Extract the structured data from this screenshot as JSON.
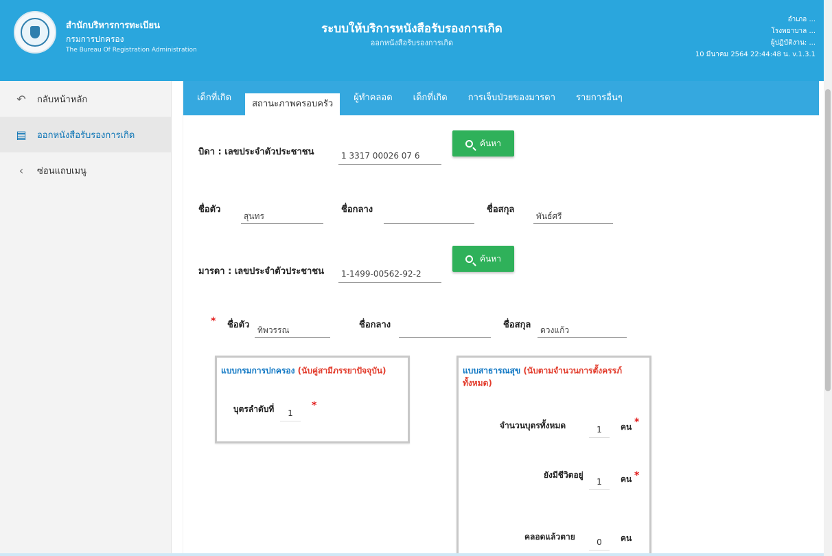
{
  "header": {
    "org_th_line1": "สำนักบริหารการทะเบียน",
    "org_th_line2": "กรมการปกครอง",
    "org_en": "The Bureau Of Registration Administration",
    "title": "ระบบให้บริการหนังสือรับรองการเกิด",
    "subtitle": "ออกหนังสือรับรองการเกิด",
    "right_line1": "อำเภอ ...",
    "right_line2": "โรงพยาบาล ...",
    "right_line3": "ผู้ปฏิบัติงาน: ...",
    "right_line4": "10 มีนาคม 2564 22:44:48 น. v.1.3.1"
  },
  "sidebar": {
    "items": [
      {
        "label": "กลับหน้าหลัก"
      },
      {
        "label": "ออกหนังสือรับรองการเกิด"
      },
      {
        "label": "ซ่อนแถบเมนู"
      }
    ]
  },
  "tabs": [
    "เด็กที่เกิด",
    "สถานะภาพครอบครัว",
    "ผู้ทำคลอด",
    "เด็กที่เกิด",
    "การเจ็บป่วยของมารดา",
    "รายการอื่นๆ"
  ],
  "father": {
    "id_label": "บิดา : เลขประจำตัวประชาชน",
    "id_value": "1 3317 00026 07 6",
    "search_label": "ค้นหา",
    "firstname_label": "ชื่อตัว",
    "firstname_value": "สุนทร",
    "middlename_label": "ชื่อกลาง",
    "middlename_value": "",
    "lastname_label": "ชื่อสกุล",
    "lastname_value": "พันธ์ศรี"
  },
  "mother": {
    "id_label": "มารดา : เลขประจำตัวประชาชน",
    "id_value": "1-1499-00562-92-2",
    "search_label": "ค้นหา",
    "required_mark": "*",
    "firstname_label": "ชื่อตัว",
    "firstname_value": "ทิพวรรณ",
    "middlename_label": "ชื่อกลาง",
    "middlename_value": "",
    "lastname_label": "ชื่อสกุล",
    "lastname_value": "ดวงแก้ว"
  },
  "card_left": {
    "title_blue": "แบบกรมการปกครอง",
    "title_red": "(นับคู่สามีภรรยาปัจจุบัน)",
    "order_label": "บุตรลำดับที่",
    "order_value": "1",
    "required_mark": "*"
  },
  "card_right": {
    "title_blue": "แบบสาธารณสุข",
    "title_red": "(นับตามจำนวนการตั้งครรภ์ทั้งหมด)",
    "total_label": "จำนวนบุตรทั้งหมด",
    "total_value": "1",
    "alive_label": "ยังมีชีวิตอยู่",
    "alive_value": "1",
    "stillborn_label": "คลอดแล้วตาย",
    "stillborn_value": "0",
    "unit": "คน",
    "required_mark": "*"
  }
}
